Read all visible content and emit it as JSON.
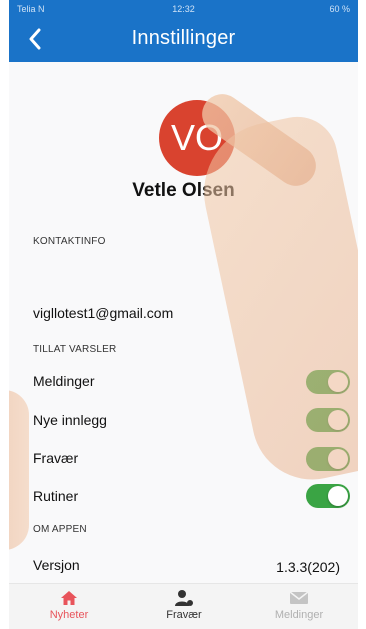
{
  "status_bar": {
    "carrier": "Telia N",
    "time": "12:32",
    "battery": "60 %"
  },
  "header": {
    "title": "Innstillinger"
  },
  "profile": {
    "initials": "VO",
    "name": "Vetle Olsen"
  },
  "sections": {
    "contact": "KONTAKTINFO",
    "notifications": "TILLAT VARSLER",
    "about": "OM APPEN"
  },
  "contact": {
    "email": "vigllotest1@gmail.com"
  },
  "notifications": [
    {
      "label": "Meldinger",
      "enabled": true
    },
    {
      "label": "Nye innlegg",
      "enabled": true
    },
    {
      "label": "Fravær",
      "enabled": true
    },
    {
      "label": "Rutiner",
      "enabled": true
    }
  ],
  "about": {
    "version_label": "Versjon",
    "version_value": "1.3.3(202)"
  },
  "tabbar": [
    {
      "label": "Nyheter",
      "icon": "home-icon"
    },
    {
      "label": "Fravær",
      "icon": "person-icon"
    },
    {
      "label": "Meldinger",
      "icon": "mail-icon"
    }
  ],
  "colors": {
    "header": "#1a73c8",
    "avatar": "#d9432f",
    "toggle_on": "#3aa444",
    "tab_active": "#e8545b"
  }
}
